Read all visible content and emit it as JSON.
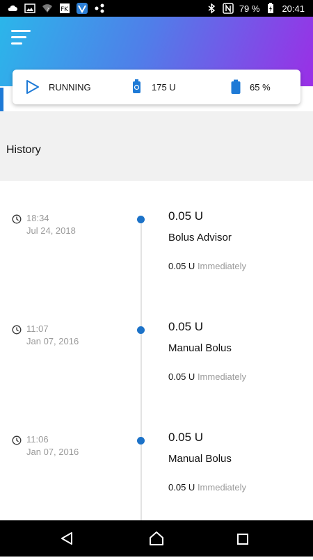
{
  "status_bar": {
    "battery_percent": "79 %",
    "time": "20:41",
    "icons": [
      "cloud-icon",
      "image-icon",
      "wifi-question-icon",
      "fk-app-icon",
      "vpn-app-icon",
      "share-icon",
      "bluetooth-icon",
      "nfc-icon",
      "battery-charging-icon"
    ]
  },
  "header": {
    "menu_icon": "hamburger-menu-icon",
    "gradient": [
      "#2bb6ea",
      "#4f7fe9",
      "#9a2fe6"
    ]
  },
  "pump_status": {
    "state_label": "RUNNING",
    "reservoir_label": "175 U",
    "battery_label": "65 %",
    "accent": "#1e7ad6"
  },
  "section": {
    "title": "History"
  },
  "history": [
    {
      "time": "18:34",
      "date": "Jul 24, 2018",
      "amount": "0.05 U",
      "type": "Bolus Advisor",
      "detail_amount": "0.05 U",
      "detail_note": "Immediately"
    },
    {
      "time": "11:07",
      "date": "Jan 07, 2016",
      "amount": "0.05 U",
      "type": "Manual Bolus",
      "detail_amount": "0.05 U",
      "detail_note": "Immediately"
    },
    {
      "time": "11:06",
      "date": "Jan 07, 2016",
      "amount": "0.05 U",
      "type": "Manual Bolus",
      "detail_amount": "0.05 U",
      "detail_note": "Immediately"
    }
  ],
  "nav": {
    "icons": [
      "back-icon",
      "home-icon",
      "recents-icon"
    ]
  }
}
